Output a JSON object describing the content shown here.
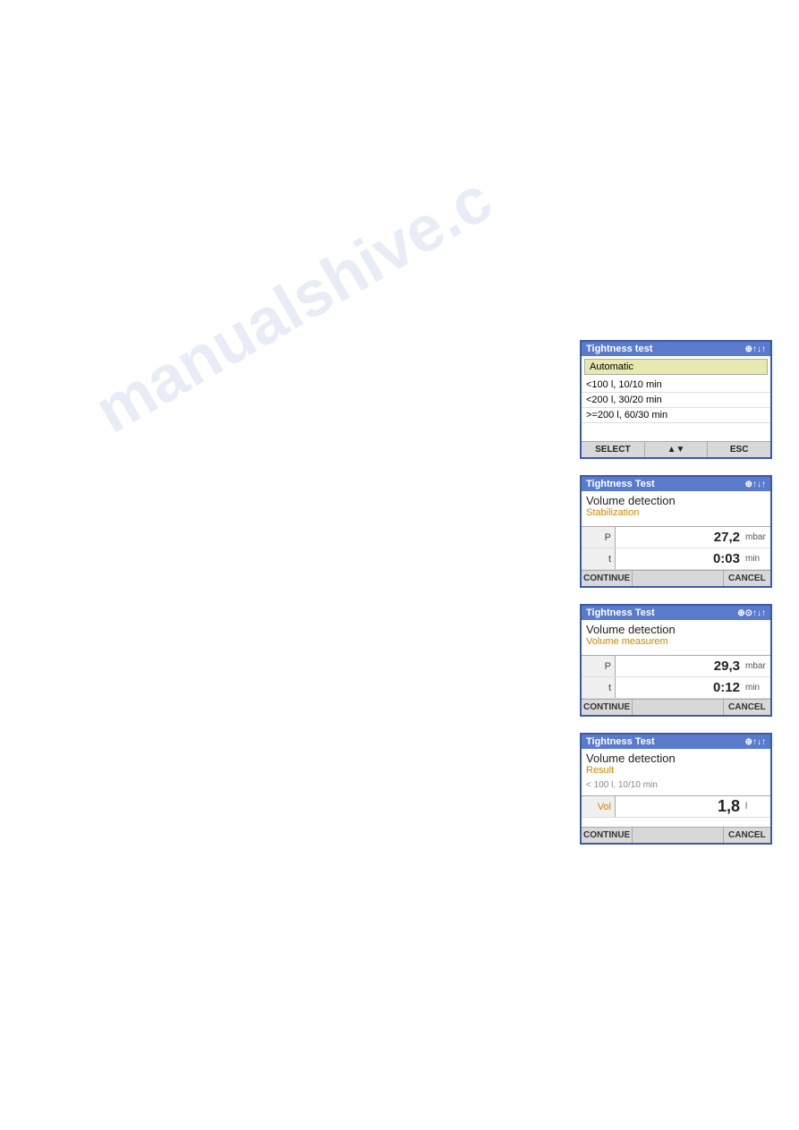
{
  "watermark": "manualshive.c",
  "panel1": {
    "header": "Tightness test",
    "header_icons": "⊕↑↓↑",
    "selected_item": "Automatic",
    "items": [
      "<100 l, 10/10 min",
      "<200 l, 30/20 min",
      ">=200 l, 60/30 min"
    ],
    "footer_buttons": [
      "SELECT",
      "▲▼",
      "ESC"
    ]
  },
  "panel2": {
    "header": "Tightness Test",
    "header_icons": "⊕↑↓↑",
    "title": "Volume detection",
    "subtitle": "Stabilization",
    "rows": [
      {
        "label": "P",
        "value": "27,2",
        "unit": "mbar"
      },
      {
        "label": "t",
        "value": "0:03",
        "unit": "min"
      }
    ],
    "footer_buttons": [
      "CONTINUE",
      "",
      "CANCEL"
    ]
  },
  "panel3": {
    "header": "Tightness Test",
    "header_icons": "⊕⊙↑↓↑",
    "title": "Volume detection",
    "subtitle": "Volume measurem",
    "rows": [
      {
        "label": "P",
        "value": "29,3",
        "unit": "mbar"
      },
      {
        "label": "t",
        "value": "0:12",
        "unit": "min"
      }
    ],
    "footer_buttons": [
      "CONTINUE",
      "",
      "CANCEL"
    ]
  },
  "panel4": {
    "header": "Tightness Test",
    "header_icons": "⊕↑↓↑",
    "title": "Volume detection",
    "subtitle": "Result",
    "subtitle2": "< 100 l, 10/10 min",
    "rows": [
      {
        "label": "Vol",
        "value": "1,8",
        "unit": "l",
        "is_vol": true
      }
    ],
    "footer_buttons": [
      "CONTINUE",
      "",
      "CANCEL"
    ]
  }
}
